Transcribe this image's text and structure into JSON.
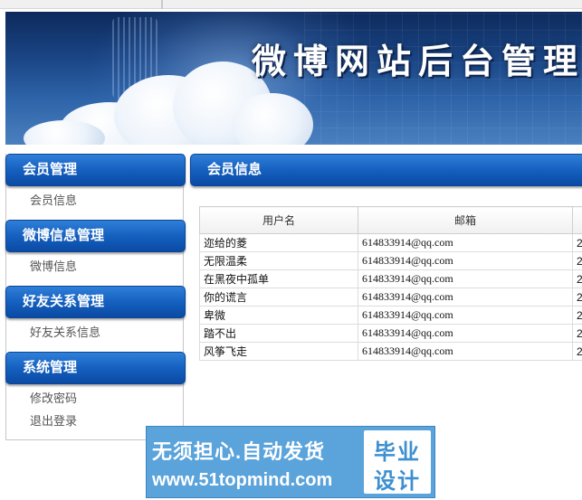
{
  "banner": {
    "title": "微博网站后台管理"
  },
  "sidebar": {
    "groups": [
      {
        "title": "会员管理",
        "items": [
          "会员信息"
        ]
      },
      {
        "title": "微博信息管理",
        "items": [
          "微博信息"
        ]
      },
      {
        "title": "好友关系管理",
        "items": [
          "好友关系信息"
        ]
      },
      {
        "title": "系统管理",
        "items": [
          "修改密码",
          "退出登录"
        ]
      }
    ]
  },
  "main": {
    "title": "会员信息",
    "table": {
      "headers": [
        "用户名",
        "邮箱",
        ""
      ],
      "rows": [
        {
          "username": "迩给的菱",
          "email": "614833914@qq.com",
          "extra": "2"
        },
        {
          "username": "无限温柔",
          "email": "614833914@qq.com",
          "extra": "2"
        },
        {
          "username": "在黑夜中孤单",
          "email": "614833914@qq.com",
          "extra": "2"
        },
        {
          "username": "你的谎言",
          "email": "614833914@qq.com",
          "extra": "2"
        },
        {
          "username": "卑微",
          "email": "614833914@qq.com",
          "extra": "2"
        },
        {
          "username": "踏不出",
          "email": "614833914@qq.com",
          "extra": "2"
        },
        {
          "username": "风筝飞走",
          "email": "614833914@qq.com",
          "extra": "2"
        }
      ]
    }
  },
  "watermark": {
    "slogan": "无须担心.自动发货",
    "url": "www.51topmind.com",
    "badge_top": "毕业",
    "badge_bottom": "设计"
  },
  "colors": {
    "menu_blue": "#1560c0",
    "ad_blue": "#5aa3db"
  }
}
